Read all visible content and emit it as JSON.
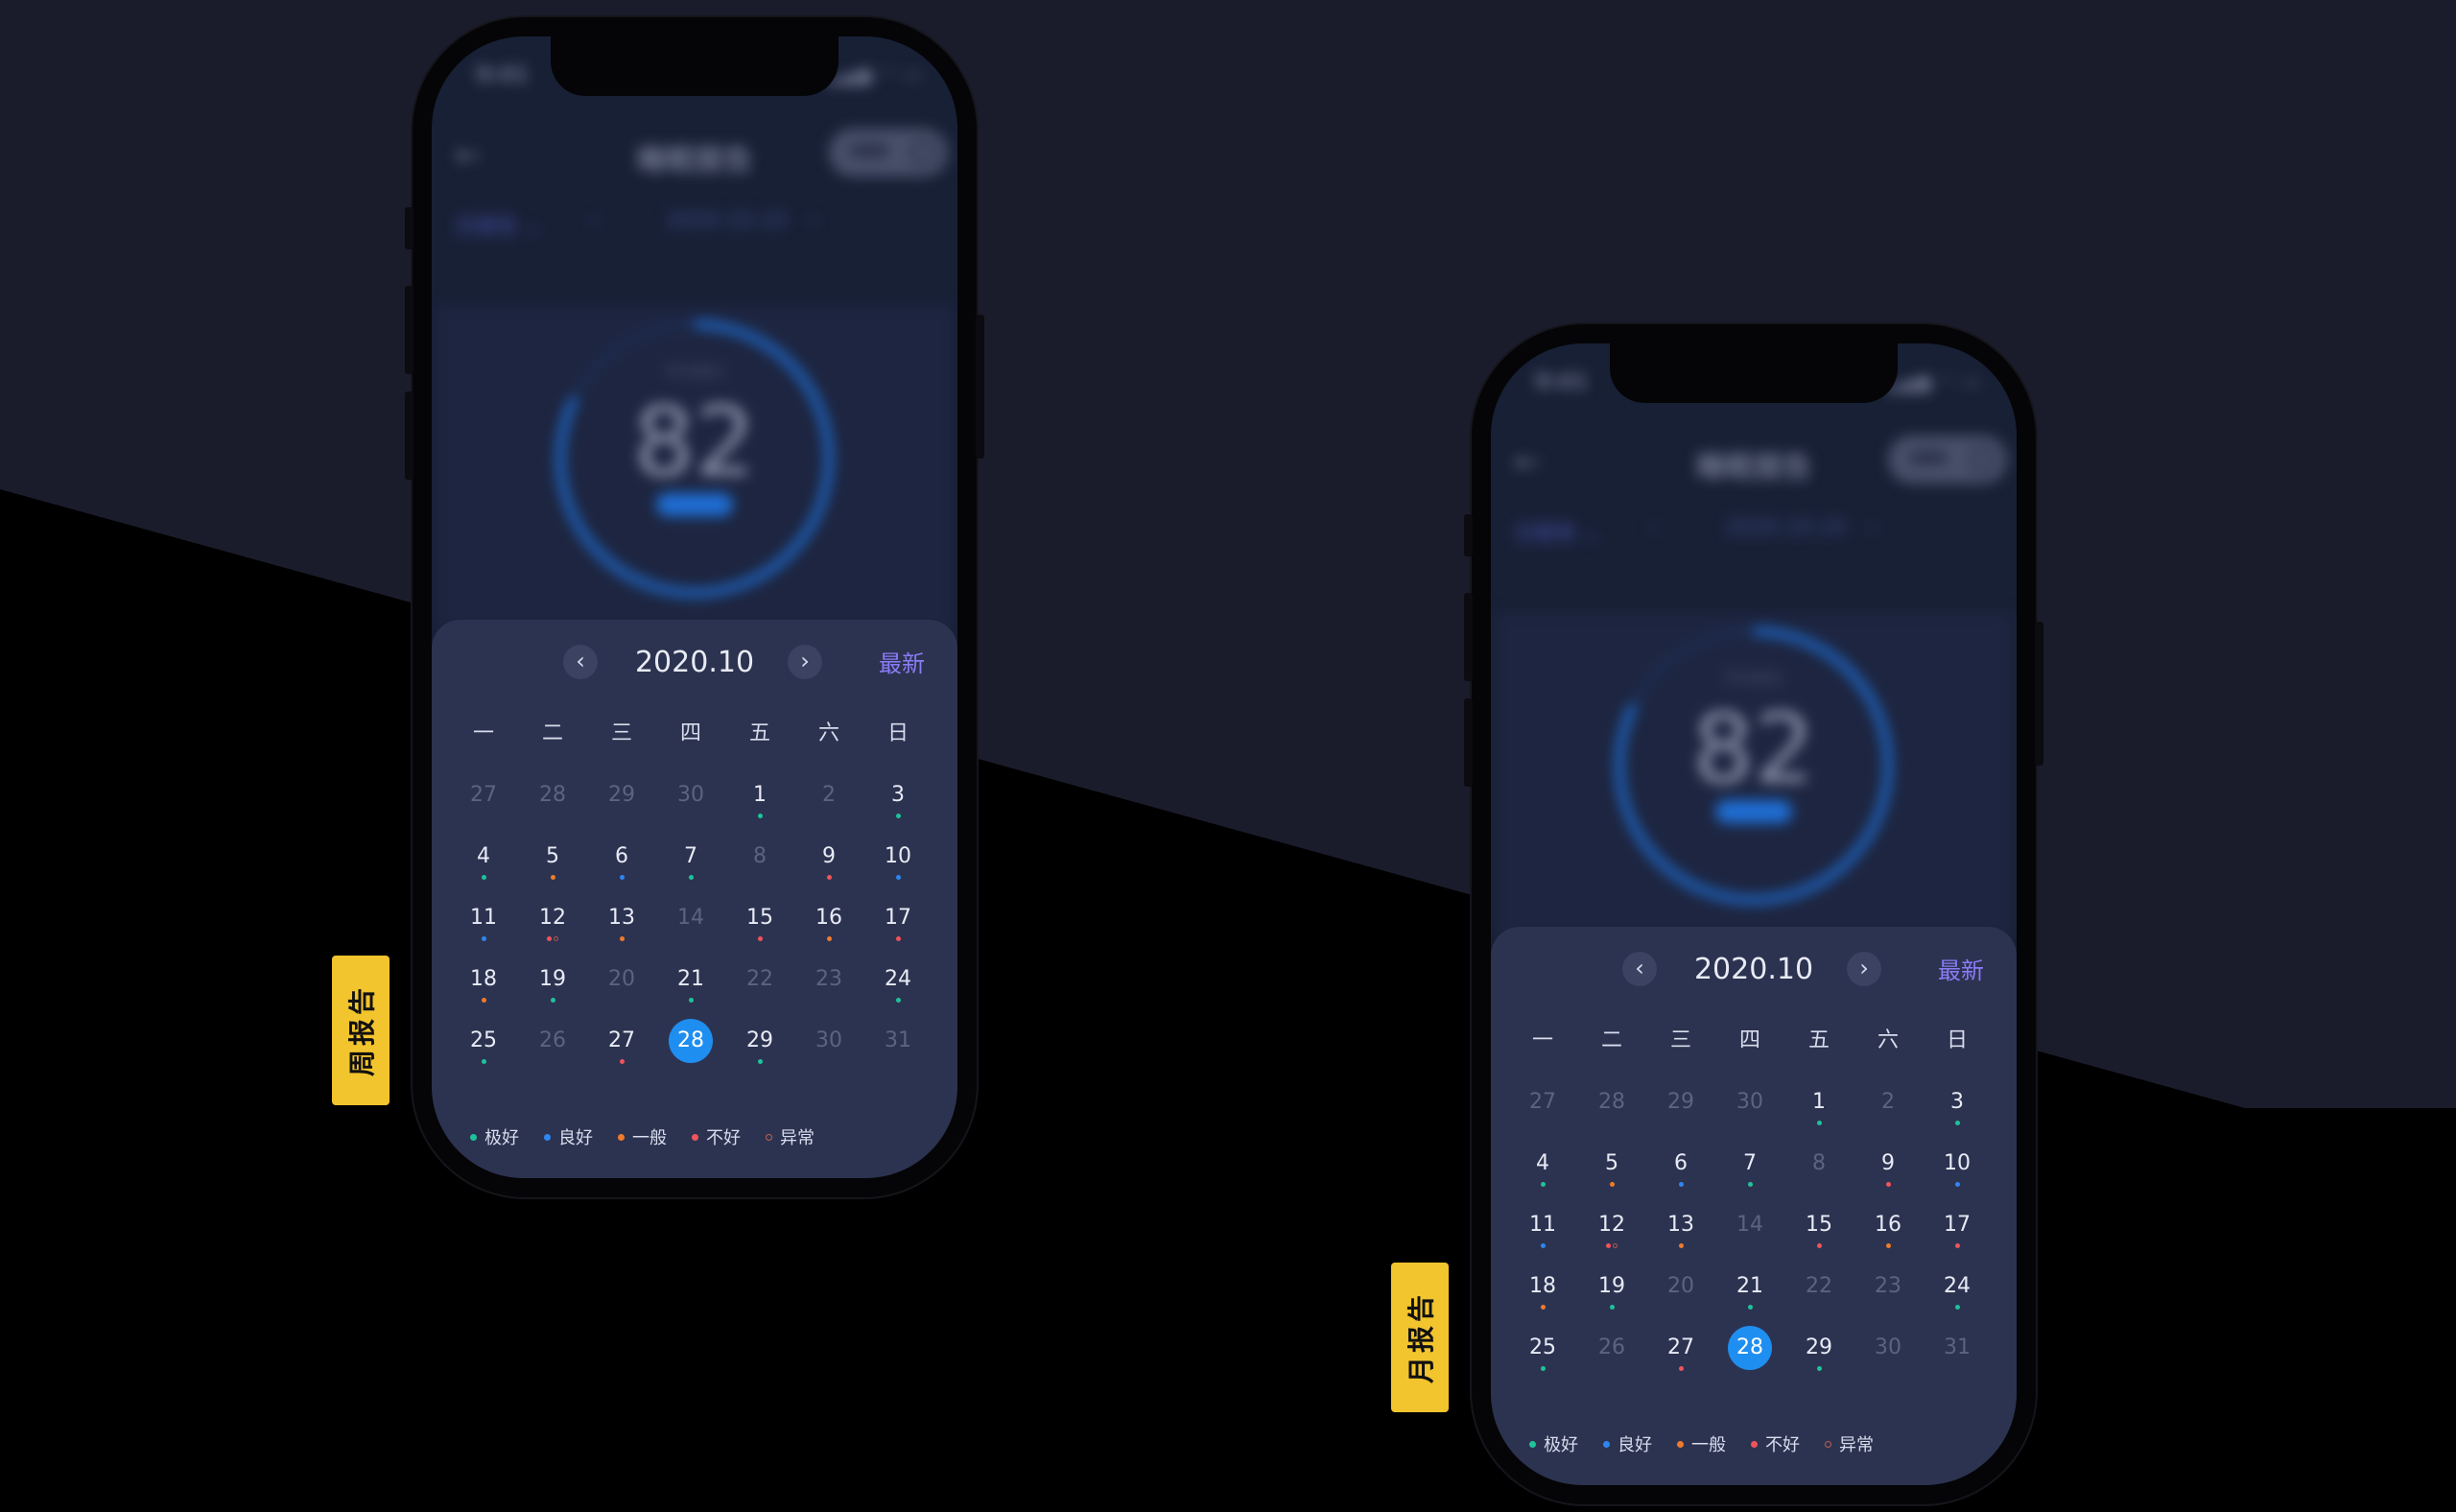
{
  "colors": {
    "background_upper": "#1b1c2b",
    "background_lower": "#000000",
    "sheet": "#2c3350",
    "selected": "#1f8ef1",
    "accent": "#8a7cf7",
    "tag": "#f2c42d"
  },
  "phones": [
    {
      "tag": "周报告",
      "blurred": {
        "status_time": "9:41",
        "status_icons": "▂▄▆ ◠ ▭",
        "back_icon": "←",
        "title": "睡眠报告",
        "filter_type": "日报告 ⌄",
        "filter_prev": "‹",
        "filter_date": "2020.10.10",
        "filter_next": "›",
        "score_label": "平均得分",
        "score_value": "82"
      },
      "calendar": {
        "month": "2020.10",
        "prev_icon": "‹",
        "next_icon": "›",
        "latest": "最新",
        "weekdays": [
          "一",
          "二",
          "三",
          "四",
          "五",
          "六",
          "日"
        ]
      }
    },
    {
      "tag": "月报告",
      "blurred": {
        "status_time": "9:41",
        "status_icons": "▂▄▆ ◠ ▭",
        "back_icon": "←",
        "title": "睡眠报告",
        "filter_type": "日报告 ⌄",
        "filter_prev": "‹",
        "filter_date": "2020.10.10",
        "filter_next": "›",
        "score_label": "平均得分",
        "score_value": "82"
      },
      "calendar": {
        "month": "2020.10",
        "prev_icon": "‹",
        "next_icon": "›",
        "latest": "最新",
        "weekdays": [
          "一",
          "二",
          "三",
          "四",
          "五",
          "六",
          "日"
        ]
      }
    }
  ],
  "days": [
    {
      "n": "27",
      "other": true
    },
    {
      "n": "28",
      "other": true
    },
    {
      "n": "29",
      "other": true
    },
    {
      "n": "30",
      "other": true
    },
    {
      "n": "1",
      "marks": [
        "excellent"
      ]
    },
    {
      "n": "2",
      "muted": true
    },
    {
      "n": "3",
      "marks": [
        "excellent"
      ]
    },
    {
      "n": "4",
      "marks": [
        "excellent"
      ]
    },
    {
      "n": "5",
      "marks": [
        "average"
      ]
    },
    {
      "n": "6",
      "marks": [
        "good"
      ]
    },
    {
      "n": "7",
      "marks": [
        "excellent"
      ]
    },
    {
      "n": "8",
      "muted": true
    },
    {
      "n": "9",
      "marks": [
        "bad"
      ]
    },
    {
      "n": "10",
      "marks": [
        "good"
      ]
    },
    {
      "n": "11",
      "marks": [
        "good"
      ]
    },
    {
      "n": "12",
      "marks": [
        "bad",
        "abnormal"
      ]
    },
    {
      "n": "13",
      "marks": [
        "average"
      ]
    },
    {
      "n": "14",
      "muted": true
    },
    {
      "n": "15",
      "marks": [
        "bad"
      ]
    },
    {
      "n": "16",
      "marks": [
        "average"
      ]
    },
    {
      "n": "17",
      "marks": [
        "bad"
      ]
    },
    {
      "n": "18",
      "marks": [
        "average"
      ]
    },
    {
      "n": "19",
      "marks": [
        "excellent"
      ]
    },
    {
      "n": "20",
      "muted": true
    },
    {
      "n": "21",
      "marks": [
        "excellent"
      ]
    },
    {
      "n": "22",
      "muted": true
    },
    {
      "n": "23",
      "muted": true
    },
    {
      "n": "24",
      "marks": [
        "excellent"
      ]
    },
    {
      "n": "25",
      "marks": [
        "excellent"
      ]
    },
    {
      "n": "26",
      "muted": true
    },
    {
      "n": "27",
      "marks": [
        "bad"
      ]
    },
    {
      "n": "28",
      "selected": true
    },
    {
      "n": "29",
      "marks": [
        "excellent"
      ]
    },
    {
      "n": "30",
      "muted": true
    },
    {
      "n": "31",
      "muted": true
    }
  ],
  "legend": [
    {
      "key": "excellent",
      "label": "极好",
      "color": "#1fc29a"
    },
    {
      "key": "good",
      "label": "良好",
      "color": "#2f86f0"
    },
    {
      "key": "average",
      "label": "一般",
      "color": "#f07a2c"
    },
    {
      "key": "bad",
      "label": "不好",
      "color": "#f0535b"
    },
    {
      "key": "abnormal",
      "label": "异常",
      "color": "#c0604f",
      "ring": true
    }
  ]
}
